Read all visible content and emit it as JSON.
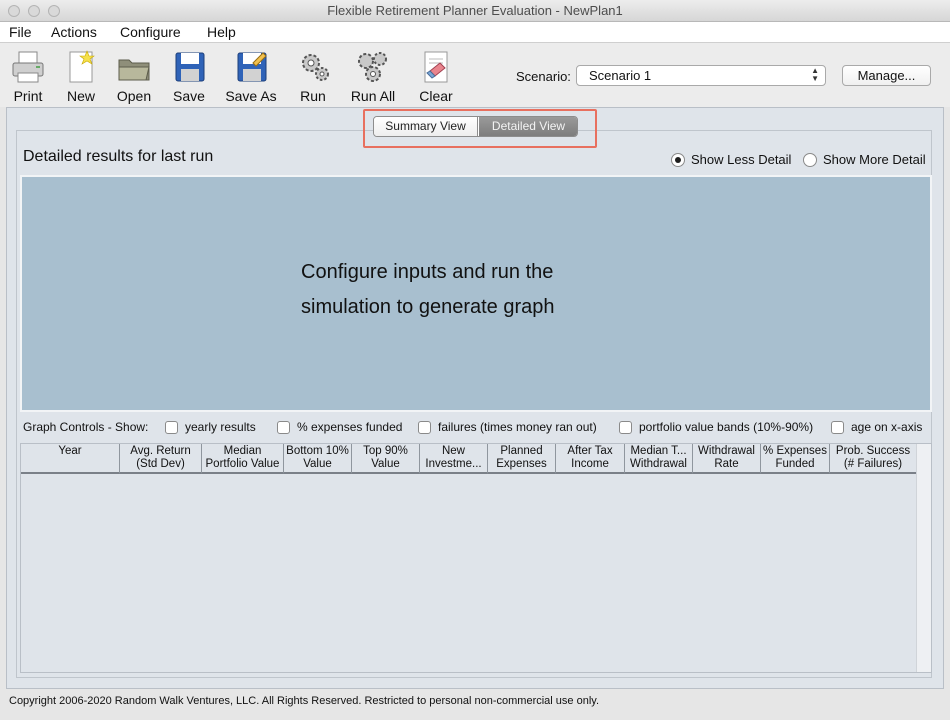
{
  "window": {
    "title": "Flexible Retirement Planner Evaluation - NewPlan1"
  },
  "menu": [
    "File",
    "Actions",
    "Configure",
    "Help"
  ],
  "toolbar": {
    "print": "Print",
    "new": "New",
    "open": "Open",
    "save": "Save",
    "save_as": "Save As",
    "run": "Run",
    "run_all": "Run All",
    "clear": "Clear"
  },
  "scenario": {
    "label": "Scenario:",
    "value": "Scenario 1",
    "manage": "Manage..."
  },
  "view_toggle": {
    "summary": "Summary View",
    "detailed": "Detailed View",
    "selected": "detailed"
  },
  "results": {
    "title": "Detailed results for last run",
    "less_detail": "Show Less Detail",
    "more_detail": "Show More Detail",
    "selected_detail": "less"
  },
  "graph": {
    "message_line1": "Configure inputs and run the",
    "message_line2": "simulation to generate graph"
  },
  "graph_controls": {
    "label": "Graph Controls - Show:",
    "options": [
      "yearly results",
      "% expenses funded",
      "failures (times money ran out)",
      "portfolio value bands (10%-90%)",
      "age on x-axis"
    ]
  },
  "table": {
    "columns": [
      [
        "",
        "Year"
      ],
      [
        "Avg. Return",
        "(Std Dev)"
      ],
      [
        "Median",
        "Portfolio Value"
      ],
      [
        "Bottom 10%",
        "Value"
      ],
      [
        "Top 90%",
        "Value"
      ],
      [
        "New",
        "Investme..."
      ],
      [
        "Planned",
        "Expenses"
      ],
      [
        "After Tax",
        "Income"
      ],
      [
        "Median T...",
        "Withdrawal"
      ],
      [
        "Withdrawal",
        "Rate"
      ],
      [
        "% Expenses",
        "Funded"
      ],
      [
        "Prob. Success",
        "(# Failures)"
      ]
    ]
  },
  "footer": "Copyright 2006-2020 Random Walk Ventures, LLC.  All Rights Reserved.   Restricted to personal non-commercial use only."
}
